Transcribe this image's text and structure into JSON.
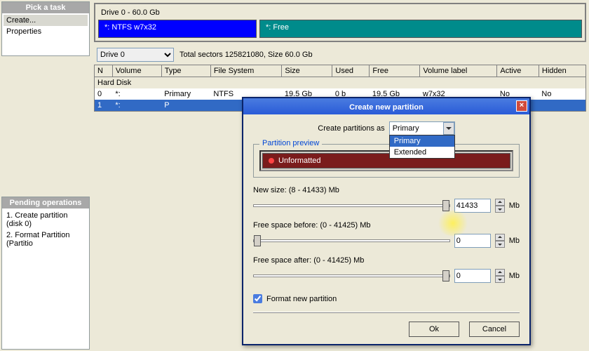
{
  "leftPanel": {
    "taskHeader": "Pick a task",
    "tasks": [
      "Create...",
      "Properties"
    ],
    "pendingHeader": "Pending operations",
    "pending": [
      "1. Create partition (disk 0)",
      "2. Format Partition (Partitio"
    ]
  },
  "driveBar": {
    "title": "Drive 0 - 60.0 Gb",
    "ntfs": "*: NTFS w7x32",
    "free": "*: Free"
  },
  "comboDrive": "Drive 0",
  "sectorsText": "Total sectors 125821080, Size 60.0 Gb",
  "table": {
    "headers": [
      "N",
      "Volume",
      "Type",
      "File System",
      "Size",
      "Used",
      "Free",
      "Volume label",
      "Active",
      "Hidden"
    ],
    "hardDisk": "Hard Disk",
    "row0": {
      "n": "0",
      "vol": "*:",
      "type": "Primary",
      "fs": "NTFS",
      "size": "19.5 Gb",
      "used": "0 b",
      "free": "19.5 Gb",
      "label": "w7x32",
      "active": "No",
      "hidden": "No"
    },
    "rowSel": {
      "n": "1",
      "vol": "*:",
      "type": "P"
    }
  },
  "dialog": {
    "title": "Create new partition",
    "createAs": "Create partitions as",
    "comboValue": "Primary",
    "options": [
      "Primary",
      "Extended"
    ],
    "previewLegend": "Partition preview",
    "previewLabel": "Unformatted",
    "newSize": {
      "label": "New size: (8 - 41433) Mb",
      "value": "41433",
      "unit": "Mb"
    },
    "freeBefore": {
      "label": "Free space before: (0 - 41425) Mb",
      "value": "0",
      "unit": "Mb"
    },
    "freeAfter": {
      "label": "Free space after: (0 - 41425) Mb",
      "value": "0",
      "unit": "Mb"
    },
    "formatCheck": "Format new partition",
    "ok": "Ok",
    "cancel": "Cancel"
  }
}
